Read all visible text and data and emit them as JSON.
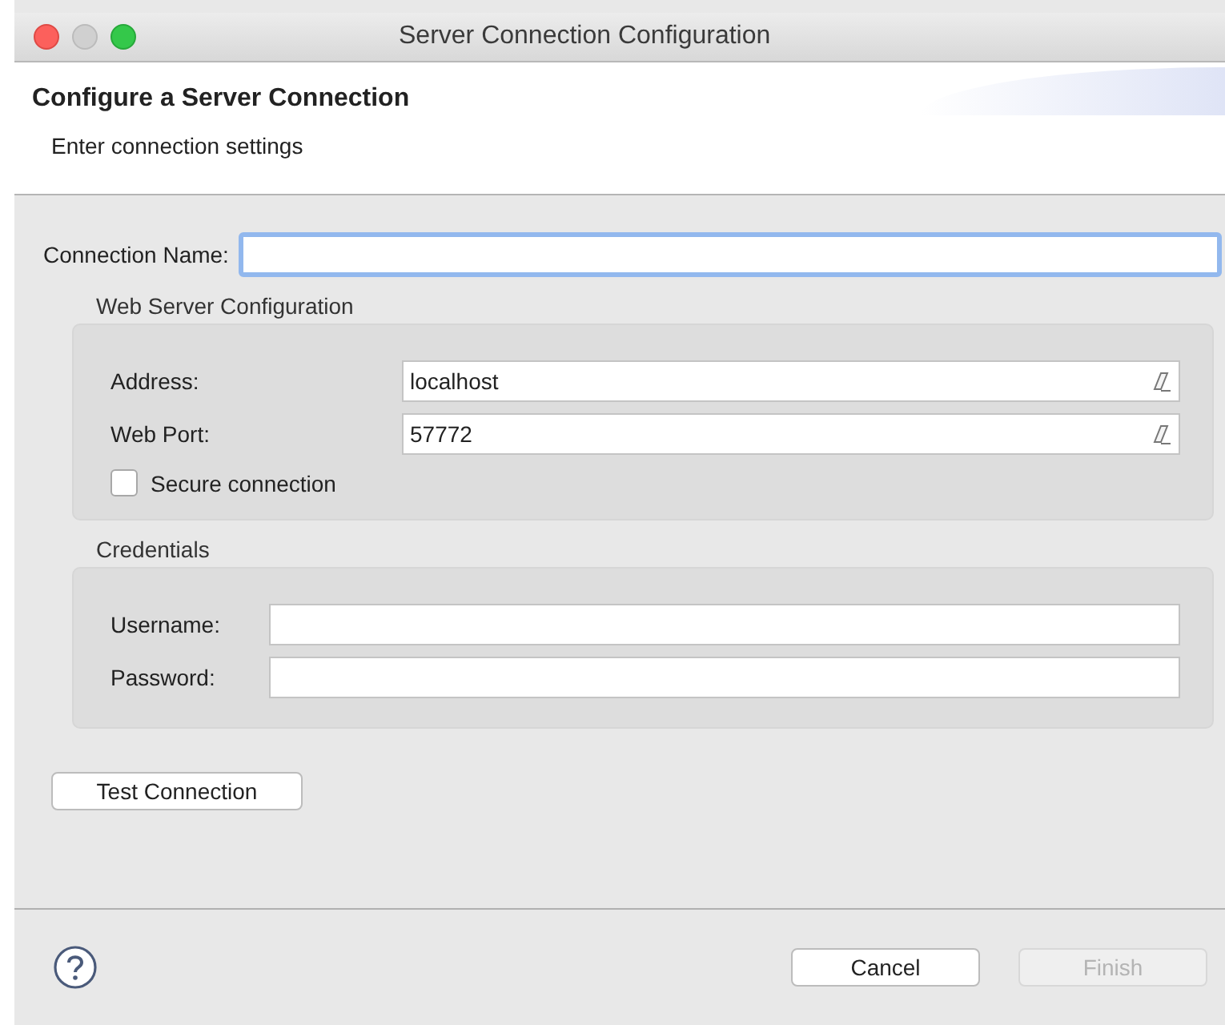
{
  "window": {
    "title": "Server Connection Configuration"
  },
  "header": {
    "title": "Configure a Server Connection",
    "subtitle": "Enter connection settings"
  },
  "connection_name": {
    "label": "Connection Name:",
    "focused": true
  },
  "groups": [
    {
      "title": "Web Server Configuration",
      "fields": [
        {
          "label": "Address:",
          "value": "localhost",
          "clearable": true
        },
        {
          "label": "Web Port:",
          "value": "57772",
          "clearable": true
        }
      ],
      "checkbox": {
        "label": "Secure connection",
        "checked": false
      }
    },
    {
      "title": "Credentials",
      "fields": [
        {
          "label": "Username:",
          "clearable": false
        },
        {
          "label": "Password:",
          "clearable": false
        }
      ]
    }
  ],
  "test_button": {
    "label": "Test Connection"
  },
  "buttons": [
    {
      "label": "Cancel",
      "disabled": false
    },
    {
      "label": "Finish",
      "disabled": true
    }
  ]
}
